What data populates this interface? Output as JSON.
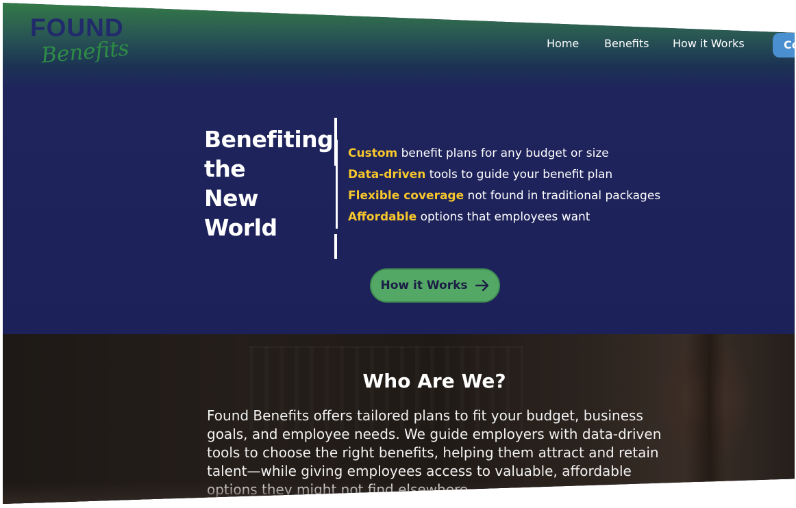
{
  "logo": {
    "word": "FOUND",
    "script": "Benefits"
  },
  "nav": {
    "items": [
      {
        "label": "Home"
      },
      {
        "label": "Benefits"
      },
      {
        "label": "How it Works"
      }
    ],
    "cta_label": "Co"
  },
  "hero": {
    "headline_lines": [
      "Benefiting",
      "the",
      "New",
      "World"
    ],
    "features": [
      {
        "highlight": "Custom",
        "text": " benefit plans for any budget or size"
      },
      {
        "highlight": "Data-driven",
        "text": " tools to guide your benefit plan"
      },
      {
        "highlight": "Flexible coverage",
        "text": " not found in traditional packages"
      },
      {
        "highlight": "Affordable",
        "text": " options that employees want"
      }
    ],
    "cta_label": "How it Works"
  },
  "about": {
    "title": "Who Are We?",
    "body": "Found Benefits offers tailored plans to fit your budget, business goals, and employee needs. We guide employers with data-driven tools to choose the right benefits, helping them attract and retain talent—while giving employees access to valuable, affordable options they might not find elsewhere."
  },
  "colors": {
    "hero_top": "#347a47",
    "hero_bg": "#1d2159",
    "highlight": "#f7c72c",
    "cta_bg": "#53a866",
    "nav_cta_bg": "#4a8fcf",
    "logo_word": "#212a6b",
    "logo_script": "#2e8c45"
  }
}
